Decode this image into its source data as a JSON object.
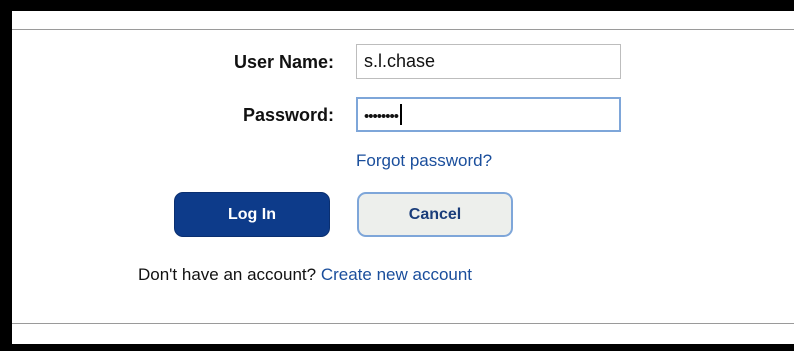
{
  "form": {
    "username_label": "User Name:",
    "username_value": "s.l.chase",
    "password_label": "Password:",
    "password_value": "••••••••",
    "forgot_link": "Forgot password?",
    "login_button": "Log In",
    "cancel_button": "Cancel",
    "no_account_text": "Don't have an account?",
    "create_account_link": "Create new account"
  }
}
